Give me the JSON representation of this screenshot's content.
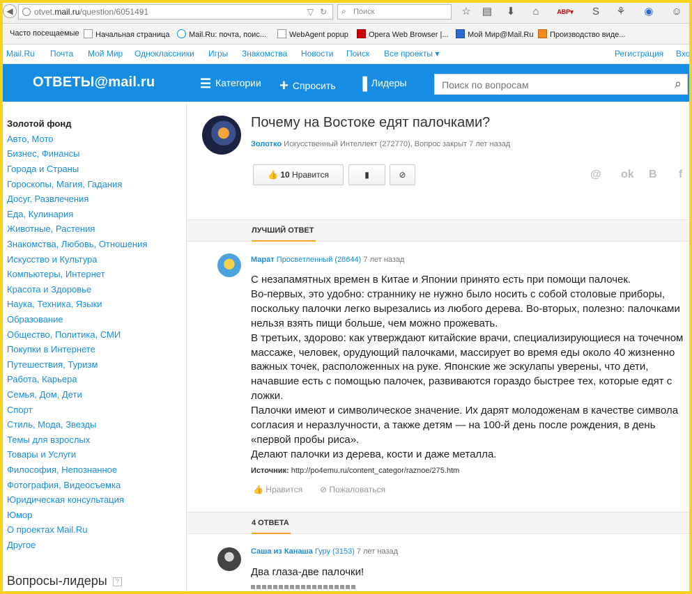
{
  "browser": {
    "url_prefix": "otvet.",
    "url_host": "mail.ru",
    "url_path": "/question/6051491",
    "search_placeholder": "Поиск",
    "bookmarks": [
      "Часто посещаемые",
      "Начальная страница",
      "Mail.Ru: почта, поис...",
      "WebAgent popup",
      "Opera Web Browser |...",
      "Мой Мир@Mail.Ru",
      "Производство виде..."
    ]
  },
  "portal_menu": {
    "items": [
      "Mail.Ru",
      "Почта",
      "Мой Мир",
      "Одноклассники",
      "Игры",
      "Знакомства",
      "Новости",
      "Поиск",
      "Все проекты ▾"
    ],
    "register": "Регистрация",
    "login": "Вхо"
  },
  "header": {
    "logo": "ОТВЕТЫ@mail.ru",
    "nav": [
      "Категории",
      "Спросить",
      "Лидеры"
    ],
    "search_placeholder": "Поиск по вопросам"
  },
  "sidebar": {
    "categories": [
      "Золотой фонд",
      "Авто, Мото",
      "Бизнес, Финансы",
      "Города и Страны",
      "Гороскопы, Магия, Гадания",
      "Досуг, Развлечения",
      "Еда, Кулинария",
      "Животные, Растения",
      "Знакомства, Любовь, Отношения",
      "Искусство и Культура",
      "Компьютеры, Интернет",
      "Красота и Здоровье",
      "Наука, Техника, Языки",
      "Образование",
      "Общество, Политика, СМИ",
      "Покупки в Интернете",
      "Путешествия, Туризм",
      "Работа, Карьера",
      "Семья, Дом, Дети",
      "Спорт",
      "Стиль, Мода, Звезды",
      "Темы для взрослых",
      "Товары и Услуги",
      "Философия, Непознанное",
      "Фотография, Видеосъемка",
      "Юридическая консультация",
      "Юмор",
      "О проектах Mail.Ru",
      "Другое"
    ],
    "leaders_title": "Вопросы-лидеры",
    "leaders_help": "?"
  },
  "question": {
    "title": "Почему на Востоке едят палочками?",
    "author": "Золотко",
    "meta": "Искусственный Интеллект (272770), Вопрос закрыт 7 лет назад",
    "likes": "10",
    "like_label": "Нравится"
  },
  "share_icons": [
    "@",
    "ok",
    "B",
    "f"
  ],
  "best_answer": {
    "section_label": "ЛУЧШИЙ ОТВЕТ",
    "author": "Марат",
    "rank": "Просветленный (28644)",
    "time": "7 лет назад",
    "paragraphs": [
      "С незапамятных времен в Китае и Японии принято есть при помощи палочек.",
      "Во-первых, это удобно: страннику не нужно было носить с собой столовые приборы, поскольку палочки легко вырезались из любого дерева. Во-вторых, полезно: палочками нельзя взять пищи больше, чем можно прожевать.",
      "В третьих, здорово: как утверждают китайские врачи, специализирующиеся на точечном массаже, человек, орудующий палочками, массирует во время еды около 40 жизненно важных точек, расположенных на руке. Японские же эскулапы уверены, что дети, начавшие есть с помощью палочек, развиваются гораздо быстрее тех, которые едят с ложки.",
      "Палочки имеют и символическое значение. Их дарят молодоженам в качестве символа согласия и неразлучности, а также детям — на 100-й день после рождения, в день «первой пробы риса».",
      "Делают палочки из дерева, кости и даже металла."
    ],
    "source_label": "Источник:",
    "source_url": "http://po4emu.ru/content_categor/raznoe/275.htm",
    "like_action": "Нравится",
    "report_action": "Пожаловаться"
  },
  "answers": {
    "section_label": "4 ОТВЕТА",
    "first": {
      "author": "Саша из Канаша",
      "rank": "Гуру (3153)",
      "time": "7 лет назад",
      "text": "Два глаза-две палочки!"
    }
  },
  "colors": {
    "brand_blue": "#168de2",
    "accent_orange": "#f5a623",
    "frame_yellow": "#f5d21e"
  }
}
